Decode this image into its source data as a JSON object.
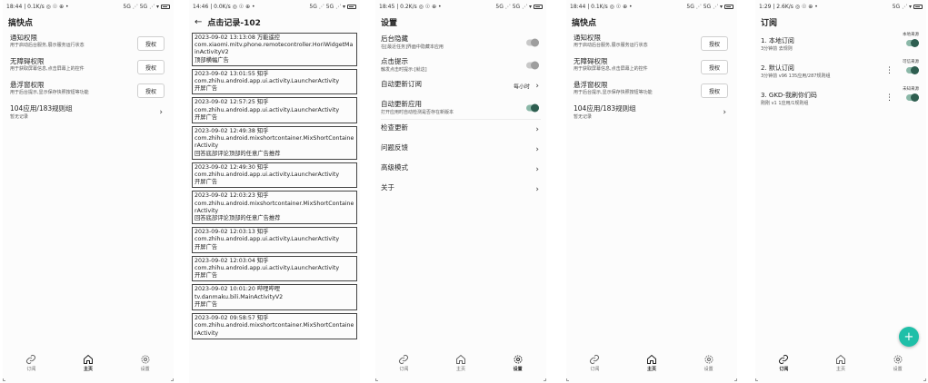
{
  "app_title": "搞快点",
  "screens": {
    "home1": {
      "status_left": "18:44 | 0.1K/s ◎ ☉ ⊕ •",
      "status_right": "5G ⋰ 5G ⋰ ▾",
      "title": "搞快点",
      "perm1_title": "通知权限",
      "perm1_desc": "用于启动后台服务,展示服务运行状态",
      "perm2_title": "无障碍权限",
      "perm2_desc": "用于获取屏幕信息,点击屏幕上的控件",
      "perm3_title": "悬浮窗权限",
      "perm3_desc": "用于后台提示,显示保存快照按钮等功能",
      "grant": "授权",
      "rules_title": "104应用/183规则组",
      "rules_desc": "暂无记录"
    },
    "log": {
      "status_left": "14:46 | 0.0K/s ◎ ☉ ⊕ •",
      "status_right": "5G ⋰ 5G ⋰ ▾",
      "title": "点击记录-102",
      "entries": [
        "2023-09-02 13:13:08 万能遥控\ncom.xiaomi.mitv.phone.remotecontroller.HoriWidgetMainActivityV2\n顶部横幅广告",
        "2023-09-02 13:01:55 知乎\ncom.zhihu.android.app.ui.activity.LauncherActivity\n开屏广告",
        "2023-09-02 12:57:25 知乎\ncom.zhihu.android.app.ui.activity.LauncherActivity\n开屏广告",
        "2023-09-02 12:49:38 知乎\ncom.zhihu.android.mixshortcontainer.MixShortContainerActivity\n回答底部评论顶部的任意广告推荐",
        "2023-09-02 12:49:30 知乎\ncom.zhihu.android.app.ui.activity.LauncherActivity\n开屏广告",
        "2023-09-02 12:03:23 知乎\ncom.zhihu.android.mixshortcontainer.MixShortContainerActivity\n回答底部评论顶部的任意广告推荐",
        "2023-09-02 12:03:13 知乎\ncom.zhihu.android.app.ui.activity.LauncherActivity\n开屏广告",
        "2023-09-02 12:03:04 知乎\ncom.zhihu.android.app.ui.activity.LauncherActivity\n开屏广告",
        "2023-09-02 10:01:20 哔哩哔哩\ntv.danmaku.bili.MainActivityV2\n开屏广告",
        "2023-09-02 09:58:57 知乎\ncom.zhihu.android.mixshortcontainer.MixShortContainerActivity"
      ]
    },
    "settings": {
      "status_left": "18:45 | 0.2K/s ◎ ☉ ⊕ •",
      "status_right": "5G ⋰ 5G ⋰ ▾",
      "title": "设置",
      "r1_title": "后台隐藏",
      "r1_desc": "在[最近任务]界面中隐藏本应用",
      "r2_title": "点击提示",
      "r2_desc": "触发点击时提示:[就这]",
      "r3_title": "自动更新订阅",
      "r3_value": "每小时",
      "r4_title": "自动更新应用",
      "r4_desc": "打开应用时自动检测是否存在新版本",
      "r5_title": "检查更新",
      "r6_title": "问题反馈",
      "r7_title": "高级模式",
      "r8_title": "关于"
    },
    "home2": {
      "status_left": "18:44 | 0.1K/s ◎ ☉ ⊕ •",
      "status_right": "5G ⋰ 5G ⋰ ▾",
      "title": "搞快点"
    },
    "subs": {
      "status_left": "1:29 | 2.6K/s ◎ ☉ ⊕ •",
      "status_right": "5G ⋰ ▾",
      "title": "订阅",
      "s1_title": "1. 本地订阅",
      "s1_desc": "3分钟前  去规则",
      "s1_tag": "本地来源",
      "s2_title": "2. 默认订阅",
      "s2_desc": "3分钟前  v96  135应用/287规则组",
      "s2_tag": "可信来源",
      "s3_title": "3. GKD-我刷你们码",
      "s3_desc": "刚刚  v1  1应用/1规则组",
      "s3_tag": "未知来源",
      "fab": "+"
    }
  },
  "nav": {
    "subs": "订阅",
    "home": "主页",
    "settings": "设置"
  },
  "colors": {
    "accent": "#1fbfa8",
    "toggle_on": "#2e5e50"
  },
  "icons": {
    "subs": "link-icon",
    "home": "home-icon",
    "settings": "gear-icon"
  }
}
